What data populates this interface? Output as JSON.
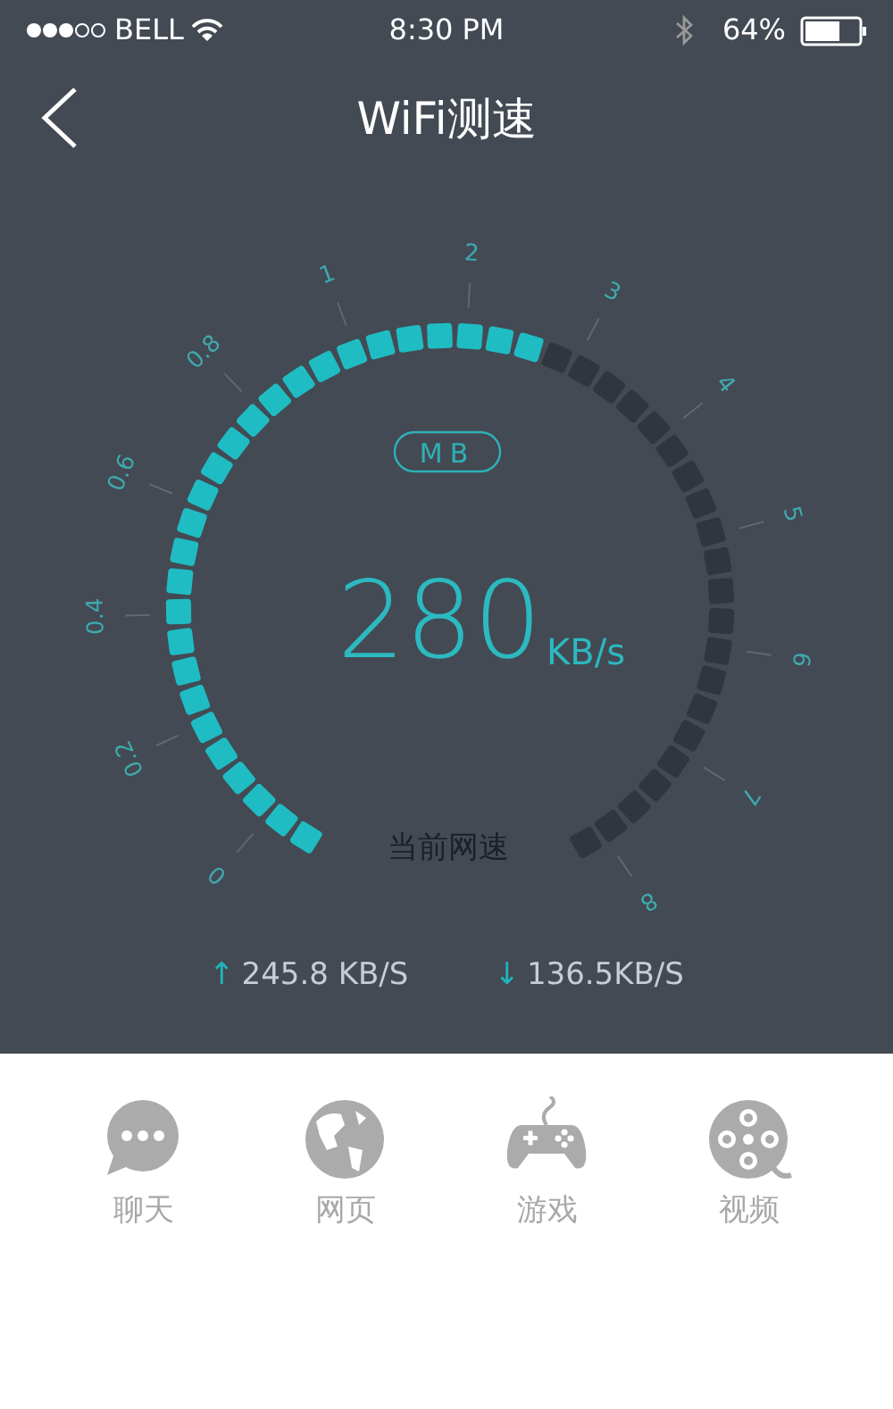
{
  "status_bar": {
    "carrier": "BELL",
    "time": "8:30 PM",
    "battery": "64%"
  },
  "header": {
    "title": "WiFi测速"
  },
  "gauge": {
    "unit": "MB",
    "speed": "280",
    "speed_unit": "KB/s",
    "caption": "当前网速",
    "scale_labels": [
      "0",
      "0.2",
      "0.4",
      "0.6",
      "0.8",
      "1",
      "2",
      "3",
      "4",
      "5",
      "6",
      "7",
      "8"
    ]
  },
  "stats": [
    {
      "arrow": "↑",
      "value": "245.8 KB/S"
    },
    {
      "arrow": "↓",
      "value": "136.5KB/S"
    }
  ],
  "categories": [
    {
      "kind": "chat",
      "label": "聊天"
    },
    {
      "kind": "web",
      "label": "网页"
    },
    {
      "kind": "game",
      "label": "游戏"
    },
    {
      "kind": "video",
      "label": "视频"
    }
  ]
}
